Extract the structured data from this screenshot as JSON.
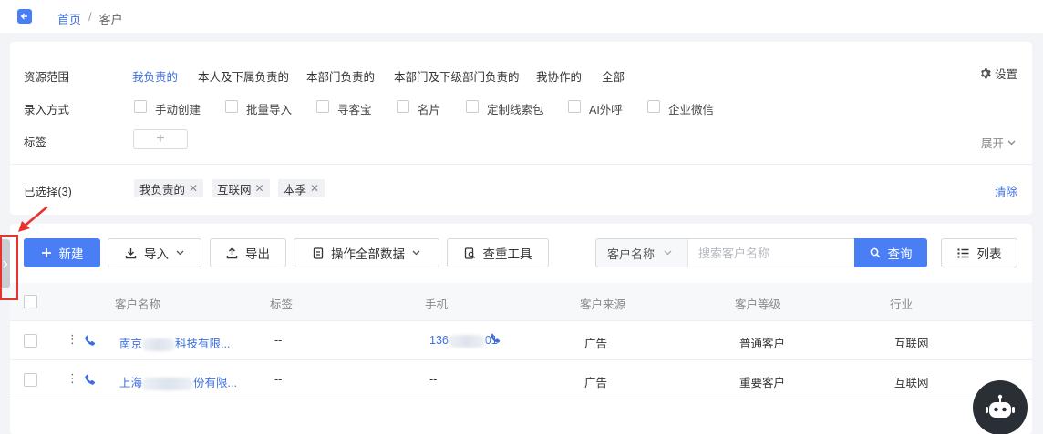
{
  "breadcrumb": {
    "home": "首页",
    "separator": "/",
    "current": "客户"
  },
  "filters": {
    "scope_label": "资源范围",
    "scope_options": [
      "我负责的",
      "本人及下属负责的",
      "本部门负责的",
      "本部门及下级部门负责的",
      "我协作的",
      "全部"
    ],
    "scope_active": "我负责的",
    "entry_label": "录入方式",
    "entry_options": [
      "手动创建",
      "批量导入",
      "寻客宝",
      "名片",
      "定制线索包",
      "AI外呼",
      "企业微信"
    ],
    "tag_label": "标签",
    "tag_add": "+",
    "settings": "设置",
    "expand": "展开",
    "selected_label": "已选择(3)",
    "selected_chips": [
      "我负责的",
      "互联网",
      "本季"
    ],
    "clear": "清除"
  },
  "toolbar": {
    "new": "新建",
    "import": "导入",
    "export": "导出",
    "bulk_ops": "操作全部数据",
    "dedupe": "查重工具",
    "search_field": "客户名称",
    "search_placeholder": "搜索客户名称",
    "search_button": "查询",
    "view_toggle": "列表"
  },
  "table": {
    "columns": [
      "客户名称",
      "标签",
      "手机",
      "客户来源",
      "客户等级",
      "行业"
    ],
    "rows": [
      {
        "name_prefix": "南京",
        "name_suffix": "科技有限...",
        "tag": "--",
        "phone_prefix": "136",
        "phone_suffix": "01",
        "source": "广告",
        "level": "普通客户",
        "industry": "互联网"
      },
      {
        "name_prefix": "上海",
        "name_suffix": "份有限...",
        "tag": "--",
        "phone": "--",
        "source": "广告",
        "level": "重要客户",
        "industry": "互联网"
      }
    ]
  },
  "colors": {
    "accent": "#4a7ef5",
    "link": "#3d6fe0",
    "highlight": "#e8322e"
  }
}
